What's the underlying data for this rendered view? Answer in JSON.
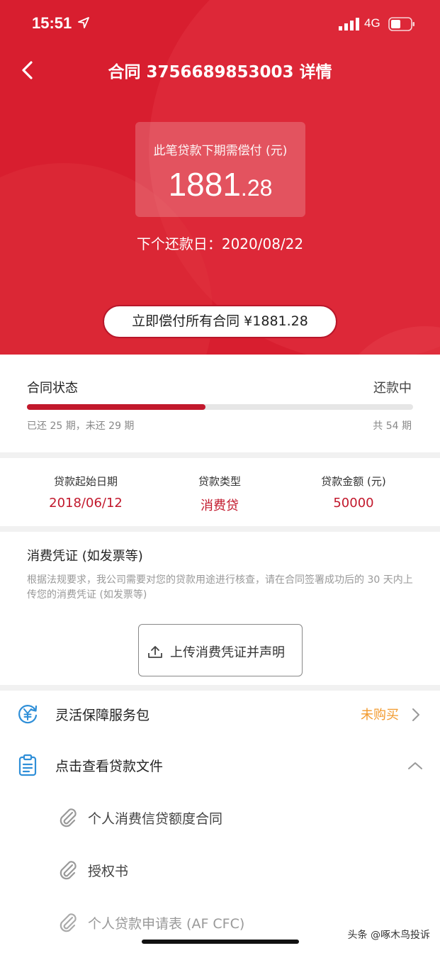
{
  "status_bar": {
    "time": "15:51",
    "network": "4G"
  },
  "nav": {
    "title": "合同 3756689853003 详情"
  },
  "hero": {
    "amount_label": "此笔贷款下期需偿付 (元)",
    "amount_int": "1881",
    "amount_dec": ".28",
    "next_date": "下个还款日：2020/08/22",
    "pay_all_button": "立即偿付所有合同 ¥1881.28"
  },
  "contract_status": {
    "label": "合同状态",
    "value": "还款中",
    "paid_text": "已还 25 期，未还 29 期",
    "total_text": "共 54 期",
    "progress_fraction": 0.463
  },
  "loan_info": [
    {
      "key": "贷款起始日期",
      "value": "2018/06/12"
    },
    {
      "key": "贷款类型",
      "value": "消费贷"
    },
    {
      "key": "贷款金额 (元)",
      "value": "50000"
    }
  ],
  "voucher": {
    "title": "消费凭证 (如发票等)",
    "description": "根据法规要求，我公司需要对您的贷款用途进行核查，请在合同签署成功后的 30 天内上传您的消费凭证 (如发票等)",
    "upload_button": "上传消费凭证并声明"
  },
  "service_row": {
    "label": "灵活保障服务包",
    "status": "未购买"
  },
  "docs_row": {
    "label": "点击查看贷款文件"
  },
  "documents": [
    "个人消费信贷额度合同",
    "授权书",
    "个人贷款申请表 (AF CFC)"
  ],
  "watermark": "头条 @啄木鸟投诉",
  "colors": {
    "brand_red": "#d81e2f",
    "accent_orange": "#f29a2e",
    "progress_red": "#c2182c"
  },
  "icons": [
    "location-arrow-icon",
    "signal-icon",
    "battery-icon",
    "back-arrow-icon",
    "upload-icon",
    "yuan-refresh-icon",
    "clipboard-icon",
    "chevron-right-icon",
    "chevron-up-icon",
    "paperclip-icon"
  ]
}
